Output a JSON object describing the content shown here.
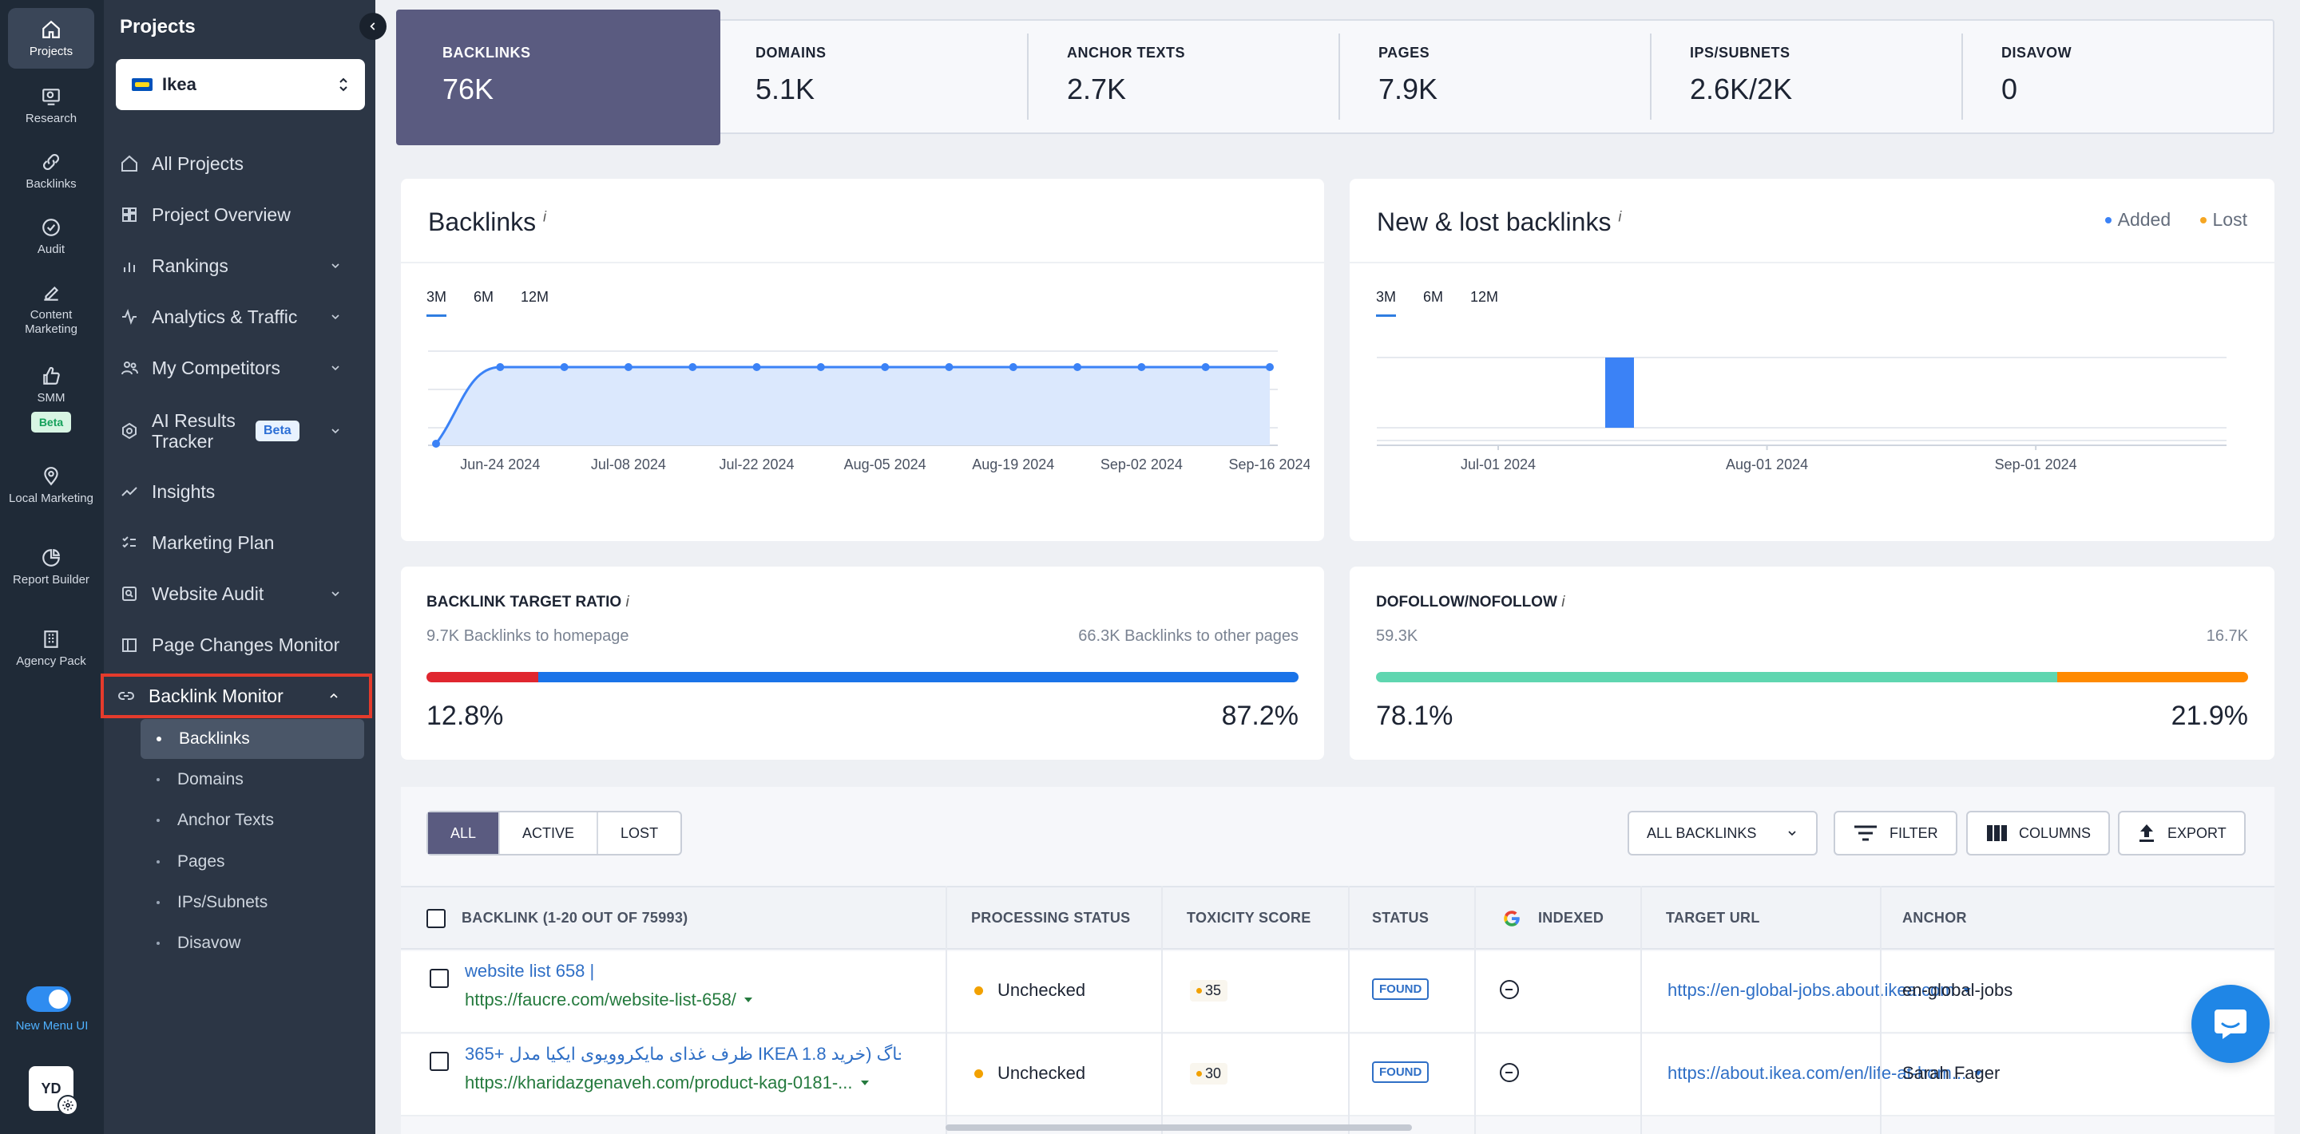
{
  "rail": {
    "items": [
      {
        "label": "Projects",
        "icon": "home-icon"
      },
      {
        "label": "Research",
        "icon": "research-icon"
      },
      {
        "label": "Backlinks",
        "icon": "link-icon"
      },
      {
        "label": "Audit",
        "icon": "check-circle-icon"
      },
      {
        "label": "Content Marketing",
        "icon": "edit-icon"
      },
      {
        "label": "SMM",
        "icon": "thumbs-up-icon",
        "badge": "Beta"
      },
      {
        "label": "Local Marketing",
        "icon": "location-pin-icon"
      },
      {
        "label": "Report Builder",
        "icon": "pie-chart-icon"
      },
      {
        "label": "Agency Pack",
        "icon": "building-icon"
      }
    ],
    "toggle_label": "New Menu UI",
    "avatar": "YD"
  },
  "nav": {
    "title": "Projects",
    "project": "Ikea",
    "items": [
      {
        "label": "All Projects"
      },
      {
        "label": "Project Overview"
      },
      {
        "label": "Rankings"
      },
      {
        "label": "Analytics & Traffic"
      },
      {
        "label": "My Competitors"
      },
      {
        "label": "AI Results Tracker",
        "badge": "Beta"
      },
      {
        "label": "Insights"
      },
      {
        "label": "Marketing Plan"
      },
      {
        "label": "Website Audit"
      },
      {
        "label": "Page Changes Monitor"
      },
      {
        "label": "Backlink Monitor"
      }
    ],
    "sub_items": [
      {
        "label": "Backlinks"
      },
      {
        "label": "Domains"
      },
      {
        "label": "Anchor Texts"
      },
      {
        "label": "Pages"
      },
      {
        "label": "IPs/Subnets"
      },
      {
        "label": "Disavow"
      }
    ]
  },
  "stats": [
    {
      "label": "BACKLINKS",
      "value": "76K"
    },
    {
      "label": "DOMAINS",
      "value": "5.1K"
    },
    {
      "label": "ANCHOR TEXTS",
      "value": "2.7K"
    },
    {
      "label": "PAGES",
      "value": "7.9K"
    },
    {
      "label": "IPS/SUBNETS",
      "value": "2.6K/2K"
    },
    {
      "label": "DISAVOW",
      "value": "0"
    }
  ],
  "backlinks_card": {
    "title": "Backlinks",
    "info": "i",
    "ranges": [
      "3M",
      "6M",
      "12M"
    ],
    "active_range": "3M"
  },
  "newlost_card": {
    "title": "New & lost backlinks",
    "info": "i",
    "ranges": [
      "3M",
      "6M",
      "12M"
    ],
    "legend": [
      {
        "label": "Added",
        "color": "#3b82f6"
      },
      {
        "label": "Lost",
        "color": "#f5a623"
      }
    ]
  },
  "chart_data": [
    {
      "type": "area",
      "title": "Backlinks",
      "x_tick_labels": [
        "Jun-24 2024",
        "Jul-08 2024",
        "Jul-22 2024",
        "Aug-05 2024",
        "Aug-19 2024",
        "Sep-02 2024",
        "Sep-16 2024"
      ],
      "x": [
        "Jun-17 2024",
        "Jun-24 2024",
        "Jul-01 2024",
        "Jul-08 2024",
        "Jul-15 2024",
        "Jul-22 2024",
        "Jul-29 2024",
        "Aug-05 2024",
        "Aug-12 2024",
        "Aug-19 2024",
        "Aug-26 2024",
        "Sep-02 2024",
        "Sep-09 2024",
        "Sep-16 2024"
      ],
      "values": [
        0,
        76,
        76,
        76,
        76,
        76,
        76,
        76,
        76,
        76,
        76,
        76,
        76,
        76
      ],
      "color": "#3b82f6",
      "grid": true
    },
    {
      "type": "bar",
      "title": "New & lost backlinks",
      "x_tick_labels": [
        "Jul-01 2024",
        "Aug-01 2024",
        "Sep-01 2024"
      ],
      "series": [
        {
          "name": "Added",
          "bars": [
            {
              "x": "Jul-15 2024",
              "value": 1
            }
          ]
        },
        {
          "name": "Lost",
          "bars": []
        }
      ],
      "grid": true
    }
  ],
  "target_ratio": {
    "title": "BACKLINK TARGET RATIO",
    "info": "i",
    "left_label": "9.7K Backlinks to homepage",
    "right_label": "66.3K Backlinks to other pages",
    "left_pct": "12.8%",
    "right_pct": "87.2%",
    "left_value": 12.8,
    "left_color": "#e0262f",
    "right_color": "#1a73e8"
  },
  "follow_ratio": {
    "title": "DOFOLLOW/NOFOLLOW",
    "info": "i",
    "left_label": "59.3K",
    "right_label": "16.7K",
    "left_pct": "78.1%",
    "right_pct": "21.9%",
    "left_value": 78.1,
    "left_color": "#5fd6b0",
    "right_color": "#ff8a00"
  },
  "table": {
    "filters": [
      "ALL",
      "ACTIVE",
      "LOST"
    ],
    "active_filter": "ALL",
    "dropdown": "ALL BACKLINKS",
    "filter_btn": "FILTER",
    "columns_btn": "COLUMNS",
    "export_btn": "EXPORT",
    "headers": [
      "BACKLINK (1-20 OUT OF 75993)",
      "PROCESSING STATUS",
      "TOXICITY SCORE",
      "STATUS",
      "INDEXED",
      "TARGET URL",
      "ANCHOR"
    ],
    "rows": [
      {
        "title": "website list 658 |",
        "url": "https://faucre.com/website-list-658/",
        "processing": "Unchecked",
        "toxicity": "35",
        "status": "FOUND",
        "target": "https://en-global-jobs.about.ikea.com",
        "anchor": "en-global-jobs"
      },
      {
        "title": "365+ ظرف غذای مایکروویوی ایکیا مدل IKEA لیتر | خاگ (خرید 1.8...",
        "url": "https://kharidazgenaveh.com/product-kag-0181-...",
        "processing": "Unchecked",
        "toxicity": "30",
        "status": "FOUND",
        "target": "https://about.ikea.com/en/life-at-hom...",
        "anchor": "Sarah Fager"
      }
    ]
  }
}
